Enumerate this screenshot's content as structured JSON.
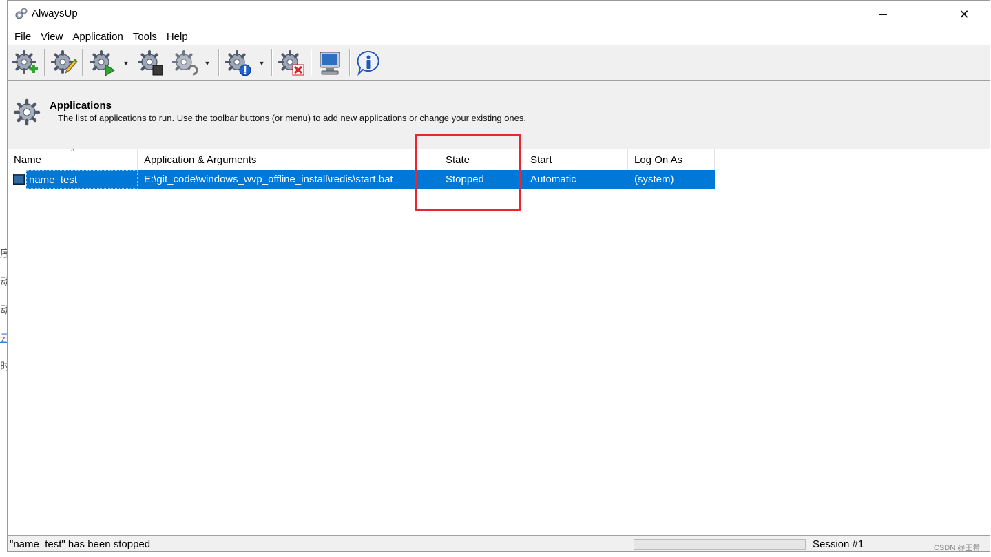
{
  "window": {
    "title": "AlwaysUp",
    "controls": {
      "minimize": "minimize",
      "maximize": "maximize",
      "close": "✕"
    }
  },
  "menu": [
    "File",
    "View",
    "Application",
    "Tools",
    "Help"
  ],
  "toolbar": {
    "buttons": [
      {
        "icon": "gear-add-icon"
      },
      {
        "icon": "gear-edit-icon"
      },
      {
        "icon": "gear-start-icon",
        "dropdown": true
      },
      {
        "icon": "gear-stop-icon"
      },
      {
        "icon": "gear-restart-icon",
        "dropdown": true
      },
      {
        "icon": "gear-info-icon",
        "dropdown": true
      },
      {
        "icon": "gear-remove-icon"
      },
      {
        "icon": "monitor-icon"
      },
      {
        "icon": "info-icon"
      }
    ]
  },
  "header": {
    "title": "Applications",
    "description": "The list of applications to run. Use the toolbar buttons (or menu) to add new applications or change your existing ones."
  },
  "table": {
    "columns": [
      "Name",
      "Application & Arguments",
      "State",
      "Start",
      "Log On As"
    ],
    "sort_indicator": "^",
    "rows": [
      {
        "name": "name_test",
        "application": "E:\\git_code\\windows_wvp_offline_install\\redis\\start.bat",
        "state": "Stopped",
        "start": "Automatic",
        "logon": "(system)",
        "selected": true
      }
    ]
  },
  "status": {
    "message": "\"name_test\" has been stopped",
    "session": "Session #1"
  },
  "watermark": "CSDN @王希",
  "background": {
    "fragments": [
      "序",
      "动",
      "动",
      "云",
      "时"
    ]
  },
  "colors": {
    "selection": "#0078d7",
    "highlight_box": "#e8282b",
    "panel": "#f0f0f0"
  }
}
